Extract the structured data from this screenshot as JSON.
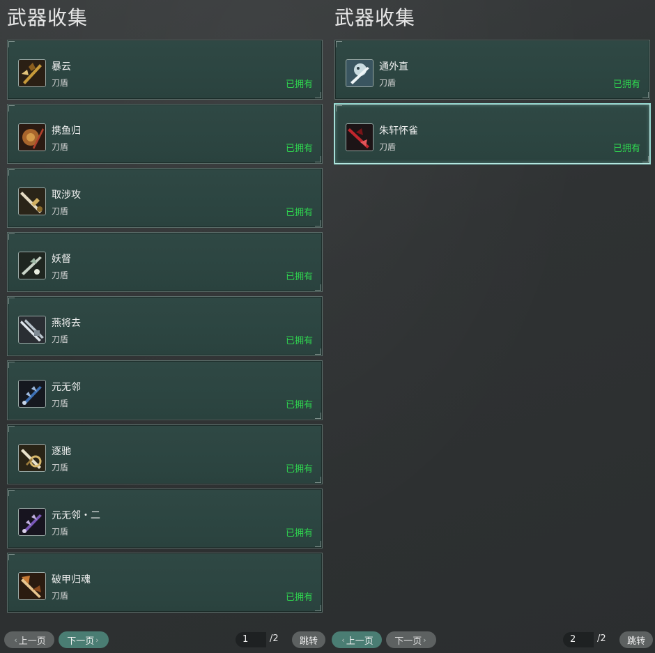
{
  "panels": [
    {
      "title": "武器收集",
      "items": [
        {
          "name": "暴云",
          "type": "刀盾",
          "status": "已拥有",
          "icon": "golden-spiked-blade-icon",
          "color": "#c79a3a"
        },
        {
          "name": "携鱼归",
          "type": "刀盾",
          "status": "已拥有",
          "icon": "round-bronze-shield-icon",
          "color": "#b0402c"
        },
        {
          "name": "取涉攻",
          "type": "刀盾",
          "status": "已拥有",
          "icon": "ornate-golden-sword-icon",
          "color": "#d2b062"
        },
        {
          "name": "妖督",
          "type": "刀盾",
          "status": "已拥有",
          "icon": "jade-blade-icon",
          "color": "#9bb6a2"
        },
        {
          "name": "燕将去",
          "type": "刀盾",
          "status": "已拥有",
          "icon": "silver-twin-blade-icon",
          "color": "#b9c4cc"
        },
        {
          "name": "元无邻",
          "type": "刀盾",
          "status": "已拥有",
          "icon": "blue-spiked-blade-icon",
          "color": "#3c6fb3"
        },
        {
          "name": "逐驰",
          "type": "刀盾",
          "status": "已拥有",
          "icon": "gold-ring-blade-icon",
          "color": "#d7b86b"
        },
        {
          "name": "元无邻・二",
          "type": "刀盾",
          "status": "已拥有",
          "icon": "purple-spiked-blade-icon",
          "color": "#7a58b8"
        },
        {
          "name": "破甲归魂",
          "type": "刀盾",
          "status": "已拥有",
          "icon": "bronze-axe-blade-icon",
          "color": "#c77a35"
        }
      ],
      "pager": {
        "prev_label": "上一页",
        "next_label": "下一页",
        "current_page": "1",
        "total": "/2",
        "jump_label": "跳转",
        "prev_enabled": false,
        "next_enabled": true
      }
    },
    {
      "title": "武器收集",
      "items": [
        {
          "name": "通外直",
          "type": "刀盾",
          "status": "已拥有",
          "icon": "white-beast-blade-icon",
          "color": "#c9dbe0"
        },
        {
          "name": "朱轩怀雀",
          "type": "刀盾",
          "status": "已拥有",
          "icon": "crimson-blade-icon",
          "color": "#c2262d",
          "selected": true
        }
      ],
      "pager": {
        "prev_label": "上一页",
        "next_label": "下一页",
        "current_page": "2",
        "total": "/2",
        "jump_label": "跳转",
        "prev_enabled": true,
        "next_enabled": false
      }
    }
  ],
  "colors": {
    "owned_status": "#2fd44f",
    "card_bg": "#2c4541",
    "selected_border": "#b7e8e2"
  }
}
